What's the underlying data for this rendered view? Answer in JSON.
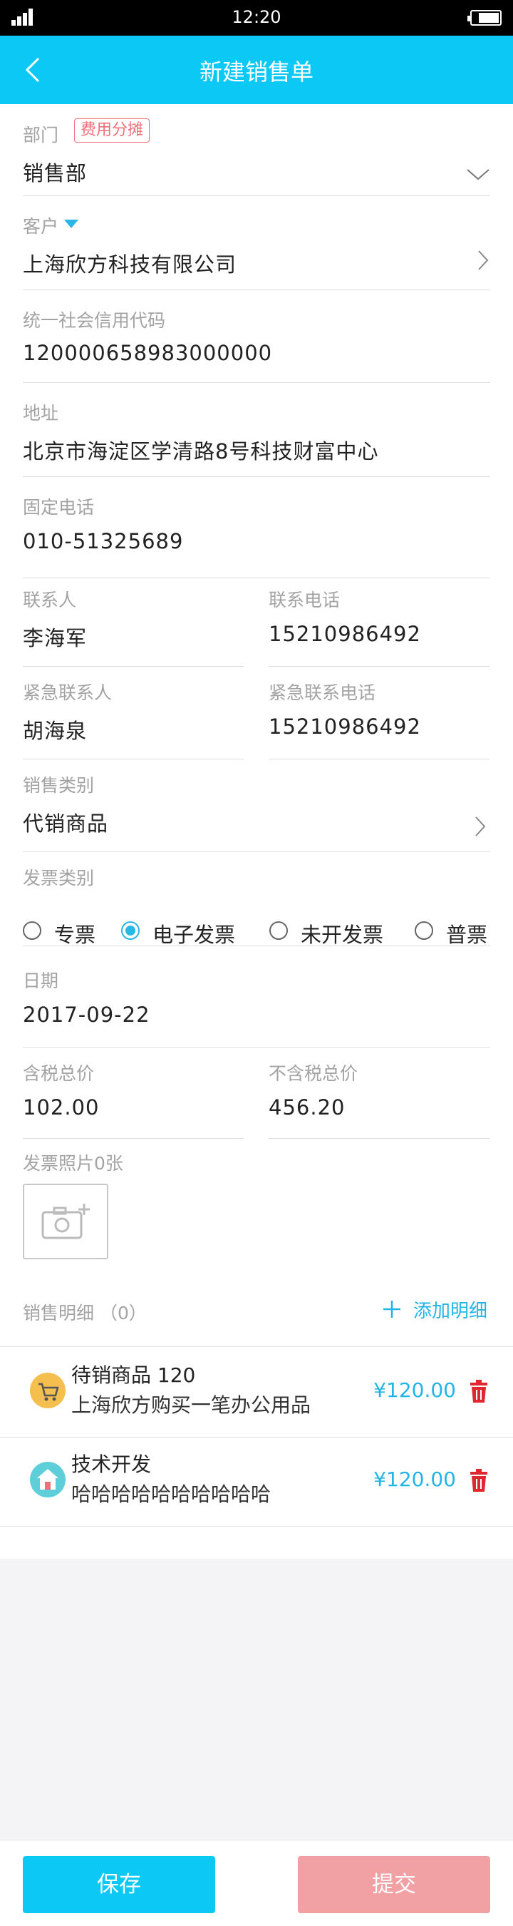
{
  "status_bar": {
    "time": "12:20"
  },
  "nav": {
    "title": "新建销售单"
  },
  "form": {
    "department": {
      "label": "部门",
      "tag": "费用分摊",
      "value": "销售部"
    },
    "customer": {
      "label": "客户",
      "value": "上海欣方科技有限公司"
    },
    "credit_code": {
      "label": "统一社会信用代码",
      "value": "120000658983000000"
    },
    "address": {
      "label": "地址",
      "value": "北京市海淀区学清路8号科技财富中心"
    },
    "phone": {
      "label": "固定电话",
      "value": "010-51325689"
    },
    "contact": {
      "label": "联系人",
      "value": "李海军"
    },
    "contact_phone": {
      "label": "联系电话",
      "value": "15210986492"
    },
    "emergency_contact": {
      "label": "紧急联系人",
      "value": "胡海泉"
    },
    "emergency_phone": {
      "label": "紧急联系电话",
      "value": "15210986492"
    },
    "sales_type": {
      "label": "销售类别",
      "value": "代销商品"
    },
    "invoice_type": {
      "label": "发票类别",
      "options": [
        "专票",
        "电子发票",
        "未开发票",
        "普票"
      ],
      "selected": "电子发票"
    },
    "date": {
      "label": "日期",
      "value": "2017-09-22"
    },
    "total_with_tax": {
      "label": "含税总价",
      "value": "102.00"
    },
    "total_without_tax": {
      "label": "不含税总价",
      "value": "456.20"
    },
    "invoice_photo": {
      "label": "发票照片0张"
    }
  },
  "sales_details": {
    "label": "销售明细 （0）",
    "add_label": "添加明细",
    "items": [
      {
        "title": "待销商品  120",
        "subtitle": "上海欣方购买一笔办公用品",
        "price": "¥120.00",
        "icon": "shopping-cart-icon",
        "icon_color": "#f5bf4f"
      },
      {
        "title": "技术开发",
        "subtitle": "哈哈哈哈哈哈哈哈哈哈",
        "price": "¥120.00",
        "icon": "house-icon",
        "icon_color": "#5ecfd9"
      }
    ]
  },
  "footer": {
    "save_label": "保存",
    "submit_label": "提交"
  },
  "colors": {
    "primary": "#0bc8f5",
    "submit": "#f1a0a4",
    "tag": "#f0707a",
    "price": "#22b5e6",
    "delete": "#e0262e"
  }
}
